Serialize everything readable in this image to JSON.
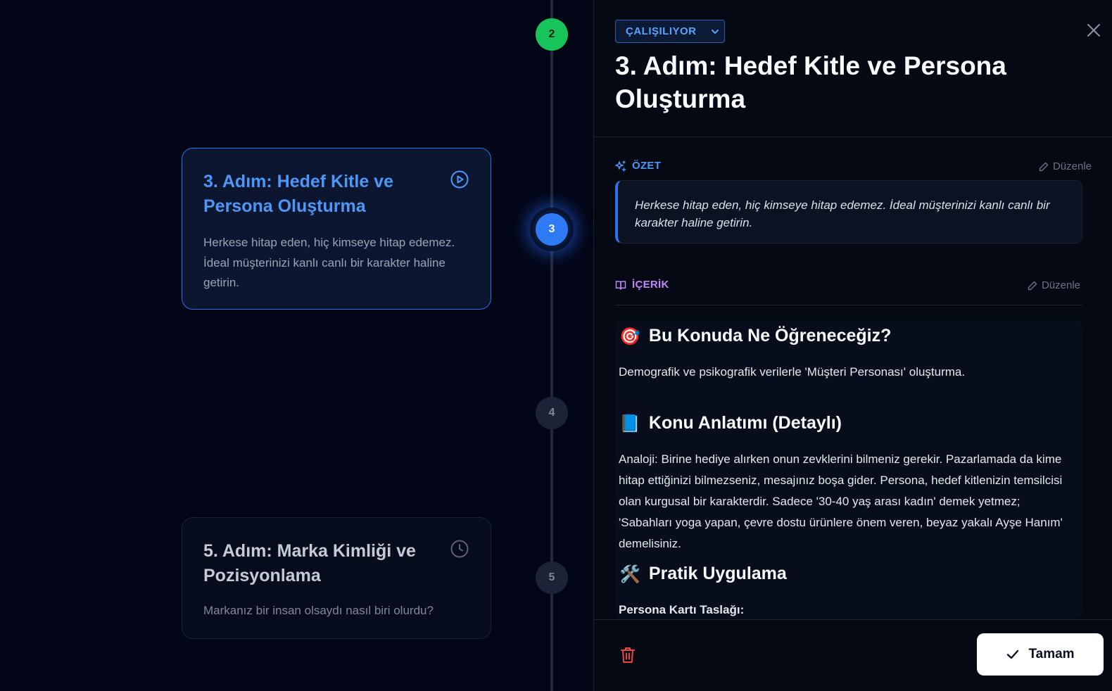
{
  "timeline": {
    "nodes": [
      {
        "number": "2",
        "status": "completed"
      },
      {
        "number": "3",
        "status": "active"
      },
      {
        "number": "4",
        "status": "pending"
      },
      {
        "number": "5",
        "status": "pending"
      }
    ],
    "cards": {
      "active": {
        "title": "3. Adım: Hedef Kitle ve Persona Oluşturma",
        "description": "Herkese hitap eden, hiç kimseye hitap edemez. İdeal müşterinizi kanlı canlı bir karakter haline getirin.",
        "icon": "play-circle-icon"
      },
      "next": {
        "title": "5. Adım: Marka Kimliği ve Pozisyonlama",
        "description": "Markanız bir insan olsaydı nasıl biri olurdu?",
        "icon": "clock-icon"
      }
    }
  },
  "panel": {
    "status": "ÇALIŞILIYOR",
    "title": "3. Adım: Hedef Kitle ve Persona Oluşturma",
    "summary": {
      "label": "ÖZET",
      "edit_label": "Düzenle",
      "text": "Herkese hitap eden, hiç kimseye hitap edemez. İdeal müşterinizi kanlı canlı bir karakter haline getirin."
    },
    "content": {
      "label": "İÇERİK",
      "edit_label": "Düzenle",
      "sections": [
        {
          "emoji": "🎯",
          "heading": "Bu Konuda Ne Öğreneceğiz?",
          "text": "Demografik ve psikografik verilerle 'Müşteri Personası' oluşturma."
        },
        {
          "emoji": "📘",
          "heading": "Konu Anlatımı (Detaylı)",
          "text": "Analoji: Birine hediye alırken onun zevklerini bilmeniz gerekir. Pazarlamada da kime hitap ettiğinizi bilmezseniz, mesajınız boşa gider. Persona, hedef kitlenizin temsilcisi olan kurgusal bir karakterdir. Sadece '30-40 yaş arası kadın' demek yetmez; 'Sabahları yoga yapan, çevre dostu ürünlere önem veren, beyaz yakalı Ayşe Hanım' demelisiniz."
        },
        {
          "emoji": "🛠️",
          "heading": "Pratik Uygulama",
          "text": "Persona Kartı Taslağı:"
        }
      ]
    },
    "footer": {
      "ok_label": "Tamam"
    }
  },
  "colors": {
    "accent_blue": "#2f7bf6",
    "success_green": "#16c45a",
    "content_purple": "#c084fc",
    "danger_red": "#ef4444"
  }
}
